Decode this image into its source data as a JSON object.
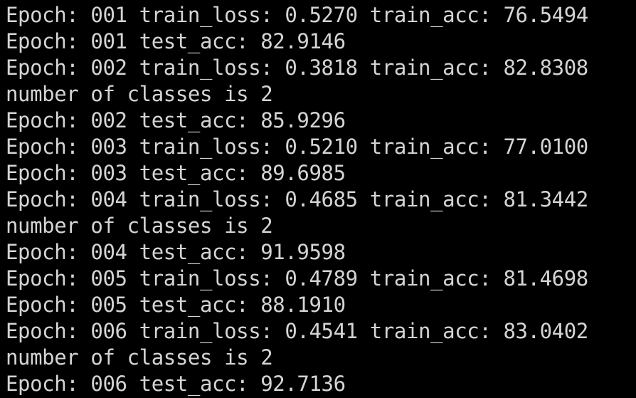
{
  "terminal": {
    "text_color": "#d4d4d4",
    "background_color": "#000000",
    "lines": [
      "Epoch: 001 train_loss: 0.5270 train_acc: 76.5494",
      "Epoch: 001 test_acc: 82.9146",
      "Epoch: 002 train_loss: 0.3818 train_acc: 82.8308",
      "number of classes is 2",
      "Epoch: 002 test_acc: 85.9296",
      "Epoch: 003 train_loss: 0.5210 train_acc: 77.0100",
      "Epoch: 003 test_acc: 89.6985",
      "Epoch: 004 train_loss: 0.4685 train_acc: 81.3442",
      "number of classes is 2",
      "Epoch: 004 test_acc: 91.9598",
      "Epoch: 005 train_loss: 0.4789 train_acc: 81.4698",
      "Epoch: 005 test_acc: 88.1910",
      "Epoch: 006 train_loss: 0.4541 train_acc: 83.0402",
      "number of classes is 2",
      "Epoch: 006 test_acc: 92.7136"
    ]
  }
}
